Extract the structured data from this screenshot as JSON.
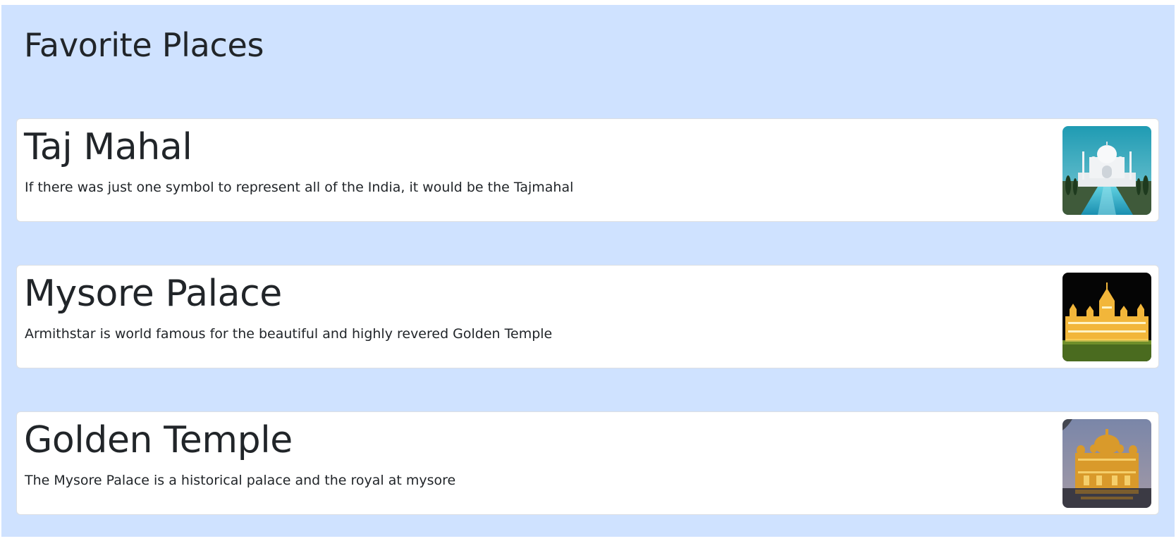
{
  "page": {
    "title": "Favorite Places",
    "background_color": "#cfe2ff"
  },
  "places": [
    {
      "name": "Taj Mahal",
      "description": "If there was just one symbol to represent all of the India, it would be the Tajmahal",
      "image_icon": "taj-mahal-photo"
    },
    {
      "name": "Mysore Palace",
      "description": "Armithstar is world famous for the beautiful and highly revered Golden Temple",
      "image_icon": "mysore-palace-photo"
    },
    {
      "name": "Golden Temple",
      "description": "The Mysore Palace is a historical palace and the royal at mysore",
      "image_icon": "golden-temple-photo"
    }
  ]
}
